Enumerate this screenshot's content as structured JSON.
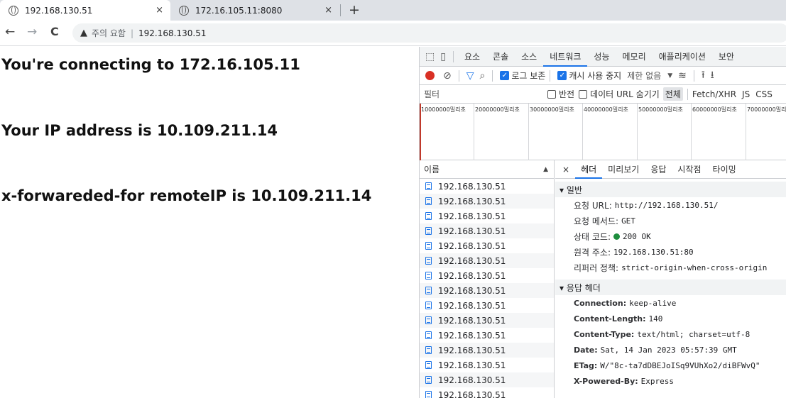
{
  "tabs": [
    {
      "title": "192.168.130.51",
      "close": "×"
    },
    {
      "title": "172.16.105.11:8080",
      "close": "×"
    }
  ],
  "new_tab": "+",
  "toolbar": {
    "back": "←",
    "forward": "→",
    "reload": "C",
    "warning_icon": "▲",
    "warning_text": "주의 요함",
    "separator": "|",
    "url": "192.168.130.51"
  },
  "page": {
    "line1": "You're connecting to 172.16.105.11",
    "line2": "Your IP address is 10.109.211.14",
    "line3": "x-forwareded-for remoteIP is 10.109.211.14"
  },
  "devtools": {
    "panel_tabs": [
      "요소",
      "콘솔",
      "소스",
      "네트워크",
      "성능",
      "메모리",
      "애플리케이션",
      "보안"
    ],
    "selected_panel": "네트워크",
    "controls": {
      "preserve_log": "로그 보존",
      "disable_cache": "캐시 사용 중지",
      "throttle": "제한 없음",
      "throttle_arrow": "▼"
    },
    "filter": {
      "placeholder": "필터",
      "invert": "반전",
      "hide_data_urls": "데이터 URL 숨기기",
      "all": "전체",
      "fetch_xhr": "Fetch/XHR",
      "js": "JS",
      "css": "CSS"
    },
    "timeline_labels": [
      "10000000밀리초",
      "20000000밀리초",
      "30000000밀리초",
      "40000000밀리초",
      "50000000밀리초",
      "60000000밀리초",
      "70000000밀리초"
    ],
    "list_header": "이름",
    "sort_icon": "▲",
    "requests": [
      "192.168.130.51",
      "192.168.130.51",
      "192.168.130.51",
      "192.168.130.51",
      "192.168.130.51",
      "192.168.130.51",
      "192.168.130.51",
      "192.168.130.51",
      "192.168.130.51",
      "192.168.130.51",
      "192.168.130.51",
      "192.168.130.51",
      "192.168.130.51",
      "192.168.130.51",
      "192.168.130.51"
    ],
    "detail_tabs": [
      "×",
      "헤더",
      "미리보기",
      "응답",
      "시작점",
      "타이밍"
    ],
    "selected_detail_tab": "헤더",
    "general": {
      "title": "▾ 일반",
      "request_url_k": "요청 URL:",
      "request_url_v": "http://192.168.130.51/",
      "method_k": "요청 메서드:",
      "method_v": "GET",
      "status_k": "상태 코드:",
      "status_v": "200 OK",
      "remote_k": "원격 주소:",
      "remote_v": "192.168.130.51:80",
      "referrer_k": "리퍼러 정책:",
      "referrer_v": "strict-origin-when-cross-origin"
    },
    "response_headers": {
      "title": "▾ 응답 헤더",
      "items": [
        {
          "k": "Connection:",
          "v": "keep-alive"
        },
        {
          "k": "Content-Length:",
          "v": "140"
        },
        {
          "k": "Content-Type:",
          "v": "text/html; charset=utf-8"
        },
        {
          "k": "Date:",
          "v": "Sat, 14 Jan 2023 05:57:39 GMT"
        },
        {
          "k": "ETag:",
          "v": "W/\"8c-ta7dDBEJoISq9VUhXo2/diBFWvQ\""
        },
        {
          "k": "X-Powered-By:",
          "v": "Express"
        }
      ]
    }
  },
  "colors": {
    "accent": "#1a73e8",
    "record": "#d93025",
    "status_ok": "#1e8e3e"
  }
}
